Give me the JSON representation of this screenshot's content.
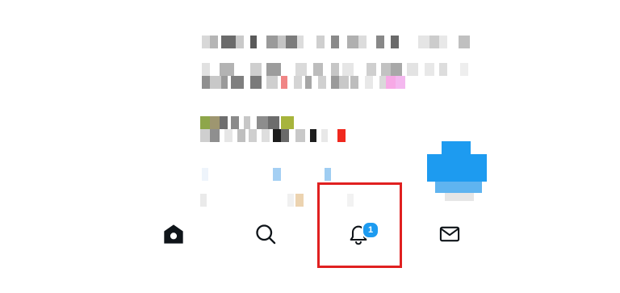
{
  "bottom_nav": {
    "tabs": [
      {
        "name": "home",
        "icon": "home-icon"
      },
      {
        "name": "search",
        "icon": "search-icon"
      },
      {
        "name": "notifications",
        "icon": "bell-icon",
        "badge": "1"
      },
      {
        "name": "messages",
        "icon": "mail-icon"
      }
    ]
  },
  "colors": {
    "accent": "#1d9bf0",
    "highlight_box": "#e02020",
    "icon": "#0f1419"
  }
}
